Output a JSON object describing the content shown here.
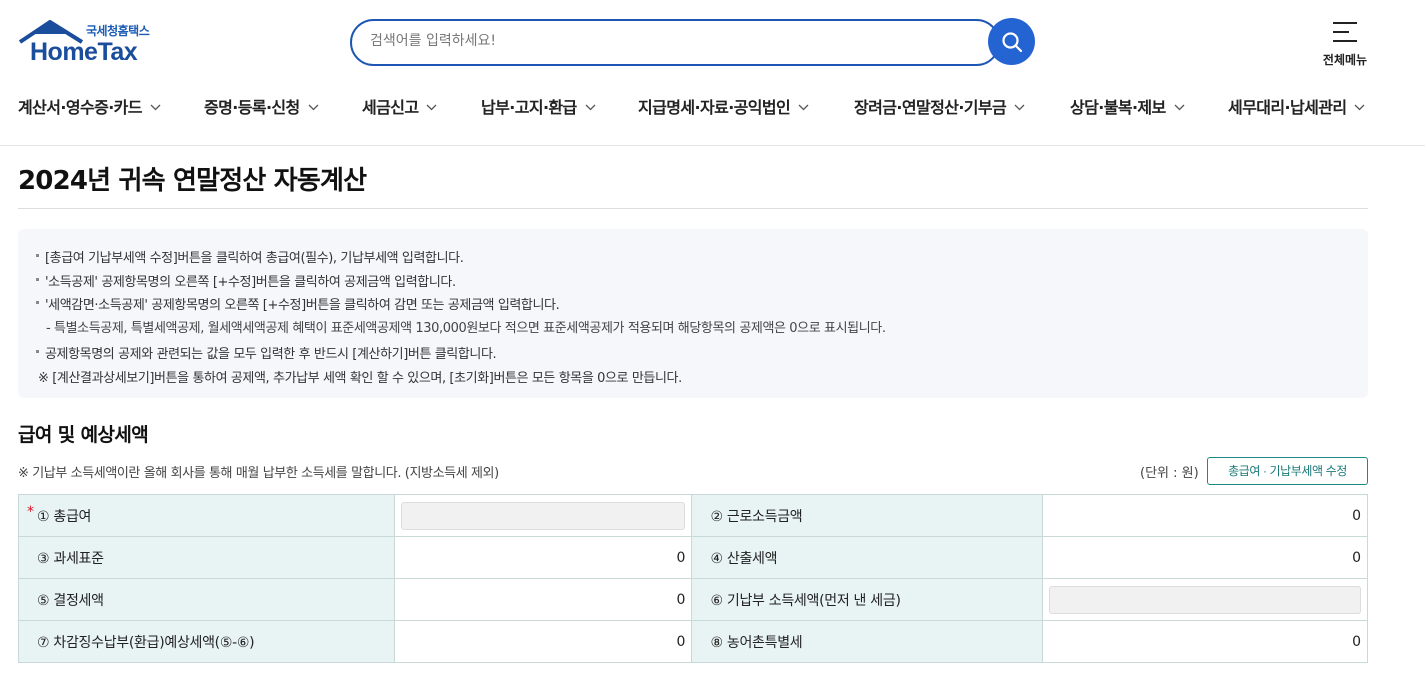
{
  "header": {
    "logo_sub": "국세청홈택스",
    "logo_main": "HomeTax",
    "search_placeholder": "검색어를 입력하세요!",
    "menu_all_label": "전체메뉴",
    "nav": [
      {
        "label": "계산서·영수증·카드"
      },
      {
        "label": "증명·등록·신청"
      },
      {
        "label": "세금신고"
      },
      {
        "label": "납부·고지·환급"
      },
      {
        "label": "지급명세·자료·공익법인"
      },
      {
        "label": "장려금·연말정산·기부금"
      },
      {
        "label": "상담·불복·제보"
      },
      {
        "label": "세무대리·납세관리"
      }
    ]
  },
  "page": {
    "title": "2024년 귀속 연말정산 자동계산"
  },
  "notice": {
    "line1": "[총급여 기납부세액 수정]버튼을 클릭하여 총급여(필수), 기납부세액 입력합니다.",
    "line2": "'소득공제' 공제항목명의 오른쪽 [+수정]버튼을 클릭하여 공제금액 입력합니다.",
    "line3": "'세액감면·소득공제' 공제항목명의 오른쪽 [+수정]버튼을 클릭하여 감면 또는 공제금액 입력합니다.",
    "line3_sub": "- 특별소득공제, 특별세액공제, 월세액세액공제 혜택이 표준세액공제액 130,000원보다 적으면 표준세액공제가 적용되며 해당항목의 공제액은 0으로 표시됩니다.",
    "line4": "공제항목명의 공제와 관련되는 값을 모두 입력한 후 반드시 [계산하기]버튼 클릭합니다.",
    "line5": "※ [계산결과상세보기]버튼을 통하여 공제액, 추가납부 세액 확인 할 수 있으며, [초기화]버튼은 모든 항목을 0으로 만듭니다."
  },
  "section": {
    "title": "급여 및 예상세액",
    "desc": "※ 기납부 소득세액이란 올해 회사를 통해 매월 납부한 소득세를 말합니다. (지방소득세 제외)",
    "unit": "(단위 : 원)",
    "edit_button": "총급여 · 기납부세액 수정"
  },
  "table": {
    "r1": {
      "l1": "① 총급여",
      "l2": "② 근로소득금액",
      "v2": "0"
    },
    "r2": {
      "l1": "③ 과세표준",
      "v1": "0",
      "l2": "④ 산출세액",
      "v2": "0"
    },
    "r3": {
      "l1": "⑤ 결정세액",
      "v1": "0",
      "l2": "⑥ 기납부 소득세액(먼저 낸 세금)"
    },
    "r4": {
      "l1": "⑦ 차감징수납부(환급)예상세액(⑤-⑥)",
      "v1": "0",
      "l2": "⑧ 농어촌특별세",
      "v2": "0"
    },
    "required_mark": "*"
  }
}
